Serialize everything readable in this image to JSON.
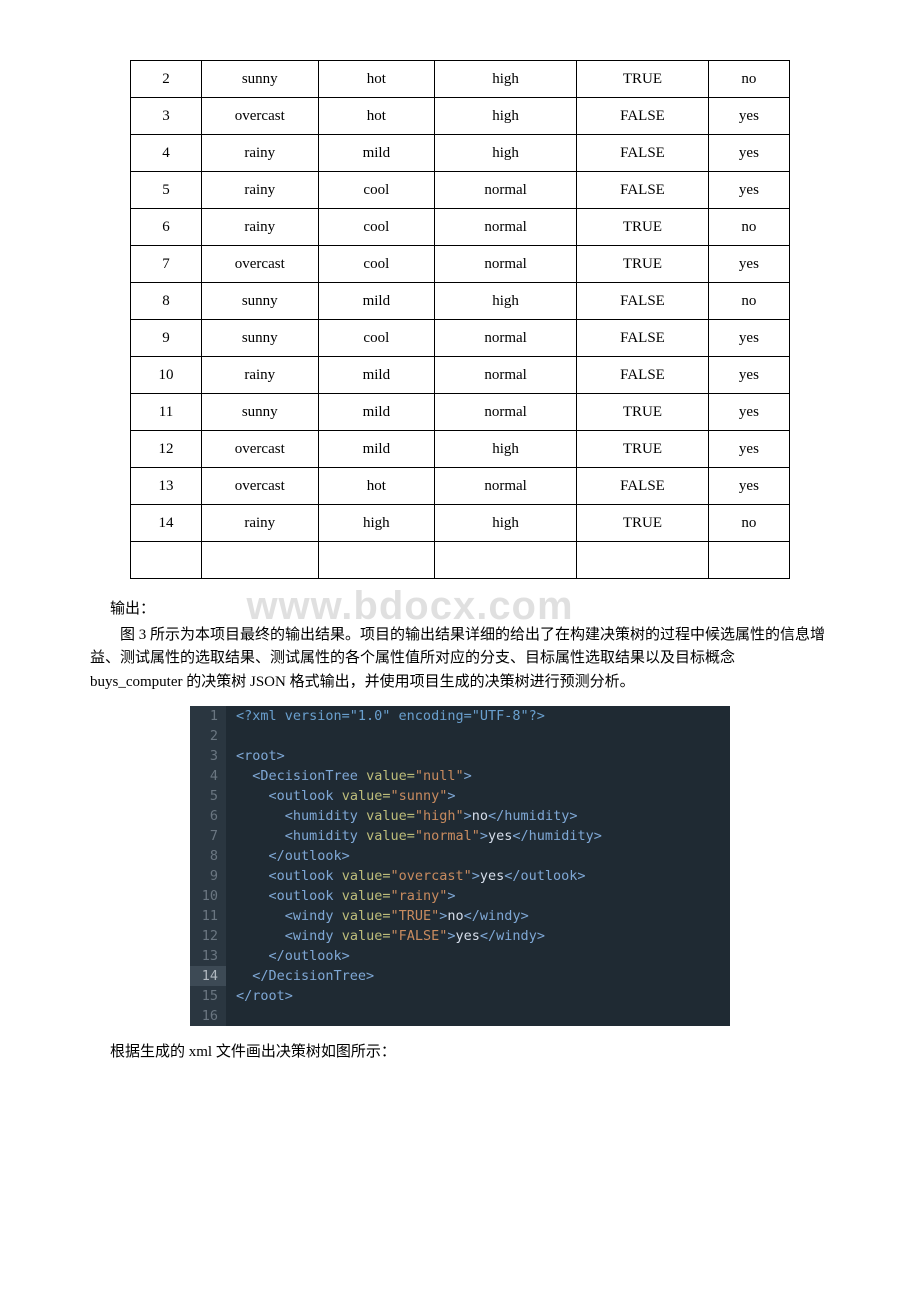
{
  "watermark": "www.bdocx.com",
  "table": {
    "rows": [
      [
        "2",
        "sunny",
        "hot",
        "high",
        "TRUE",
        "no"
      ],
      [
        "3",
        "overcast",
        "hot",
        "high",
        "FALSE",
        "yes"
      ],
      [
        "4",
        "rainy",
        "mild",
        "high",
        "FALSE",
        "yes"
      ],
      [
        "5",
        "rainy",
        "cool",
        "normal",
        "FALSE",
        "yes"
      ],
      [
        "6",
        "rainy",
        "cool",
        "normal",
        "TRUE",
        "no"
      ],
      [
        "7",
        "overcast",
        "cool",
        "normal",
        "TRUE",
        "yes"
      ],
      [
        "8",
        "sunny",
        "mild",
        "high",
        "FALSE",
        "no"
      ],
      [
        "9",
        "sunny",
        "cool",
        "normal",
        "FALSE",
        "yes"
      ],
      [
        "10",
        "rainy",
        "mild",
        "normal",
        "FALSE",
        "yes"
      ],
      [
        "11",
        "sunny",
        "mild",
        "normal",
        "TRUE",
        "yes"
      ],
      [
        "12",
        "overcast",
        "mild",
        "high",
        "TRUE",
        "yes"
      ],
      [
        "13",
        "overcast",
        "hot",
        "normal",
        "FALSE",
        "yes"
      ],
      [
        "14",
        "rainy",
        "high",
        "high",
        "TRUE",
        "no"
      ],
      [
        "",
        "",
        "",
        "",
        "",
        ""
      ]
    ]
  },
  "labels": {
    "output": "输出：",
    "footer": "根据生成的 xml 文件画出决策树如图所示："
  },
  "paragraph": "图 3 所示为本项目最终的输出结果。项目的输出结果详细的给出了在构建决策树的过程中候选属性的信息增益、测试属性的选取结果、测试属性的各个属性值所对应的分支、目标属性选取结果以及目标概念 buys_computer 的决策树 JSON 格式输出，并使用项目生成的决策树进行预测分析。",
  "code": {
    "lines": [
      {
        "n": "1",
        "type": "decl",
        "raw": "<?xml version=\"1.0\" encoding=\"UTF-8\"?>"
      },
      {
        "n": "2",
        "type": "blank"
      },
      {
        "n": "3",
        "type": "open",
        "indent": 0,
        "tag": "root"
      },
      {
        "n": "4",
        "type": "open",
        "indent": 1,
        "tag": "DecisionTree",
        "attr": "value",
        "val": "null"
      },
      {
        "n": "5",
        "type": "open",
        "indent": 2,
        "tag": "outlook",
        "attr": "value",
        "val": "sunny"
      },
      {
        "n": "6",
        "type": "leaf",
        "indent": 3,
        "tag": "humidity",
        "attr": "value",
        "val": "high",
        "text": "no"
      },
      {
        "n": "7",
        "type": "leaf",
        "indent": 3,
        "tag": "humidity",
        "attr": "value",
        "val": "normal",
        "text": "yes"
      },
      {
        "n": "8",
        "type": "close",
        "indent": 2,
        "tag": "outlook"
      },
      {
        "n": "9",
        "type": "leaf",
        "indent": 2,
        "tag": "outlook",
        "attr": "value",
        "val": "overcast",
        "text": "yes"
      },
      {
        "n": "10",
        "type": "open",
        "indent": 2,
        "tag": "outlook",
        "attr": "value",
        "val": "rainy"
      },
      {
        "n": "11",
        "type": "leaf",
        "indent": 3,
        "tag": "windy",
        "attr": "value",
        "val": "TRUE",
        "text": "no"
      },
      {
        "n": "12",
        "type": "leaf",
        "indent": 3,
        "tag": "windy",
        "attr": "value",
        "val": "FALSE",
        "text": "yes"
      },
      {
        "n": "13",
        "type": "close",
        "indent": 2,
        "tag": "outlook"
      },
      {
        "n": "14",
        "type": "close",
        "indent": 1,
        "tag": "DecisionTree",
        "hl": true
      },
      {
        "n": "15",
        "type": "close",
        "indent": 0,
        "tag": "root"
      },
      {
        "n": "16",
        "type": "blank",
        "cut": true
      }
    ]
  }
}
